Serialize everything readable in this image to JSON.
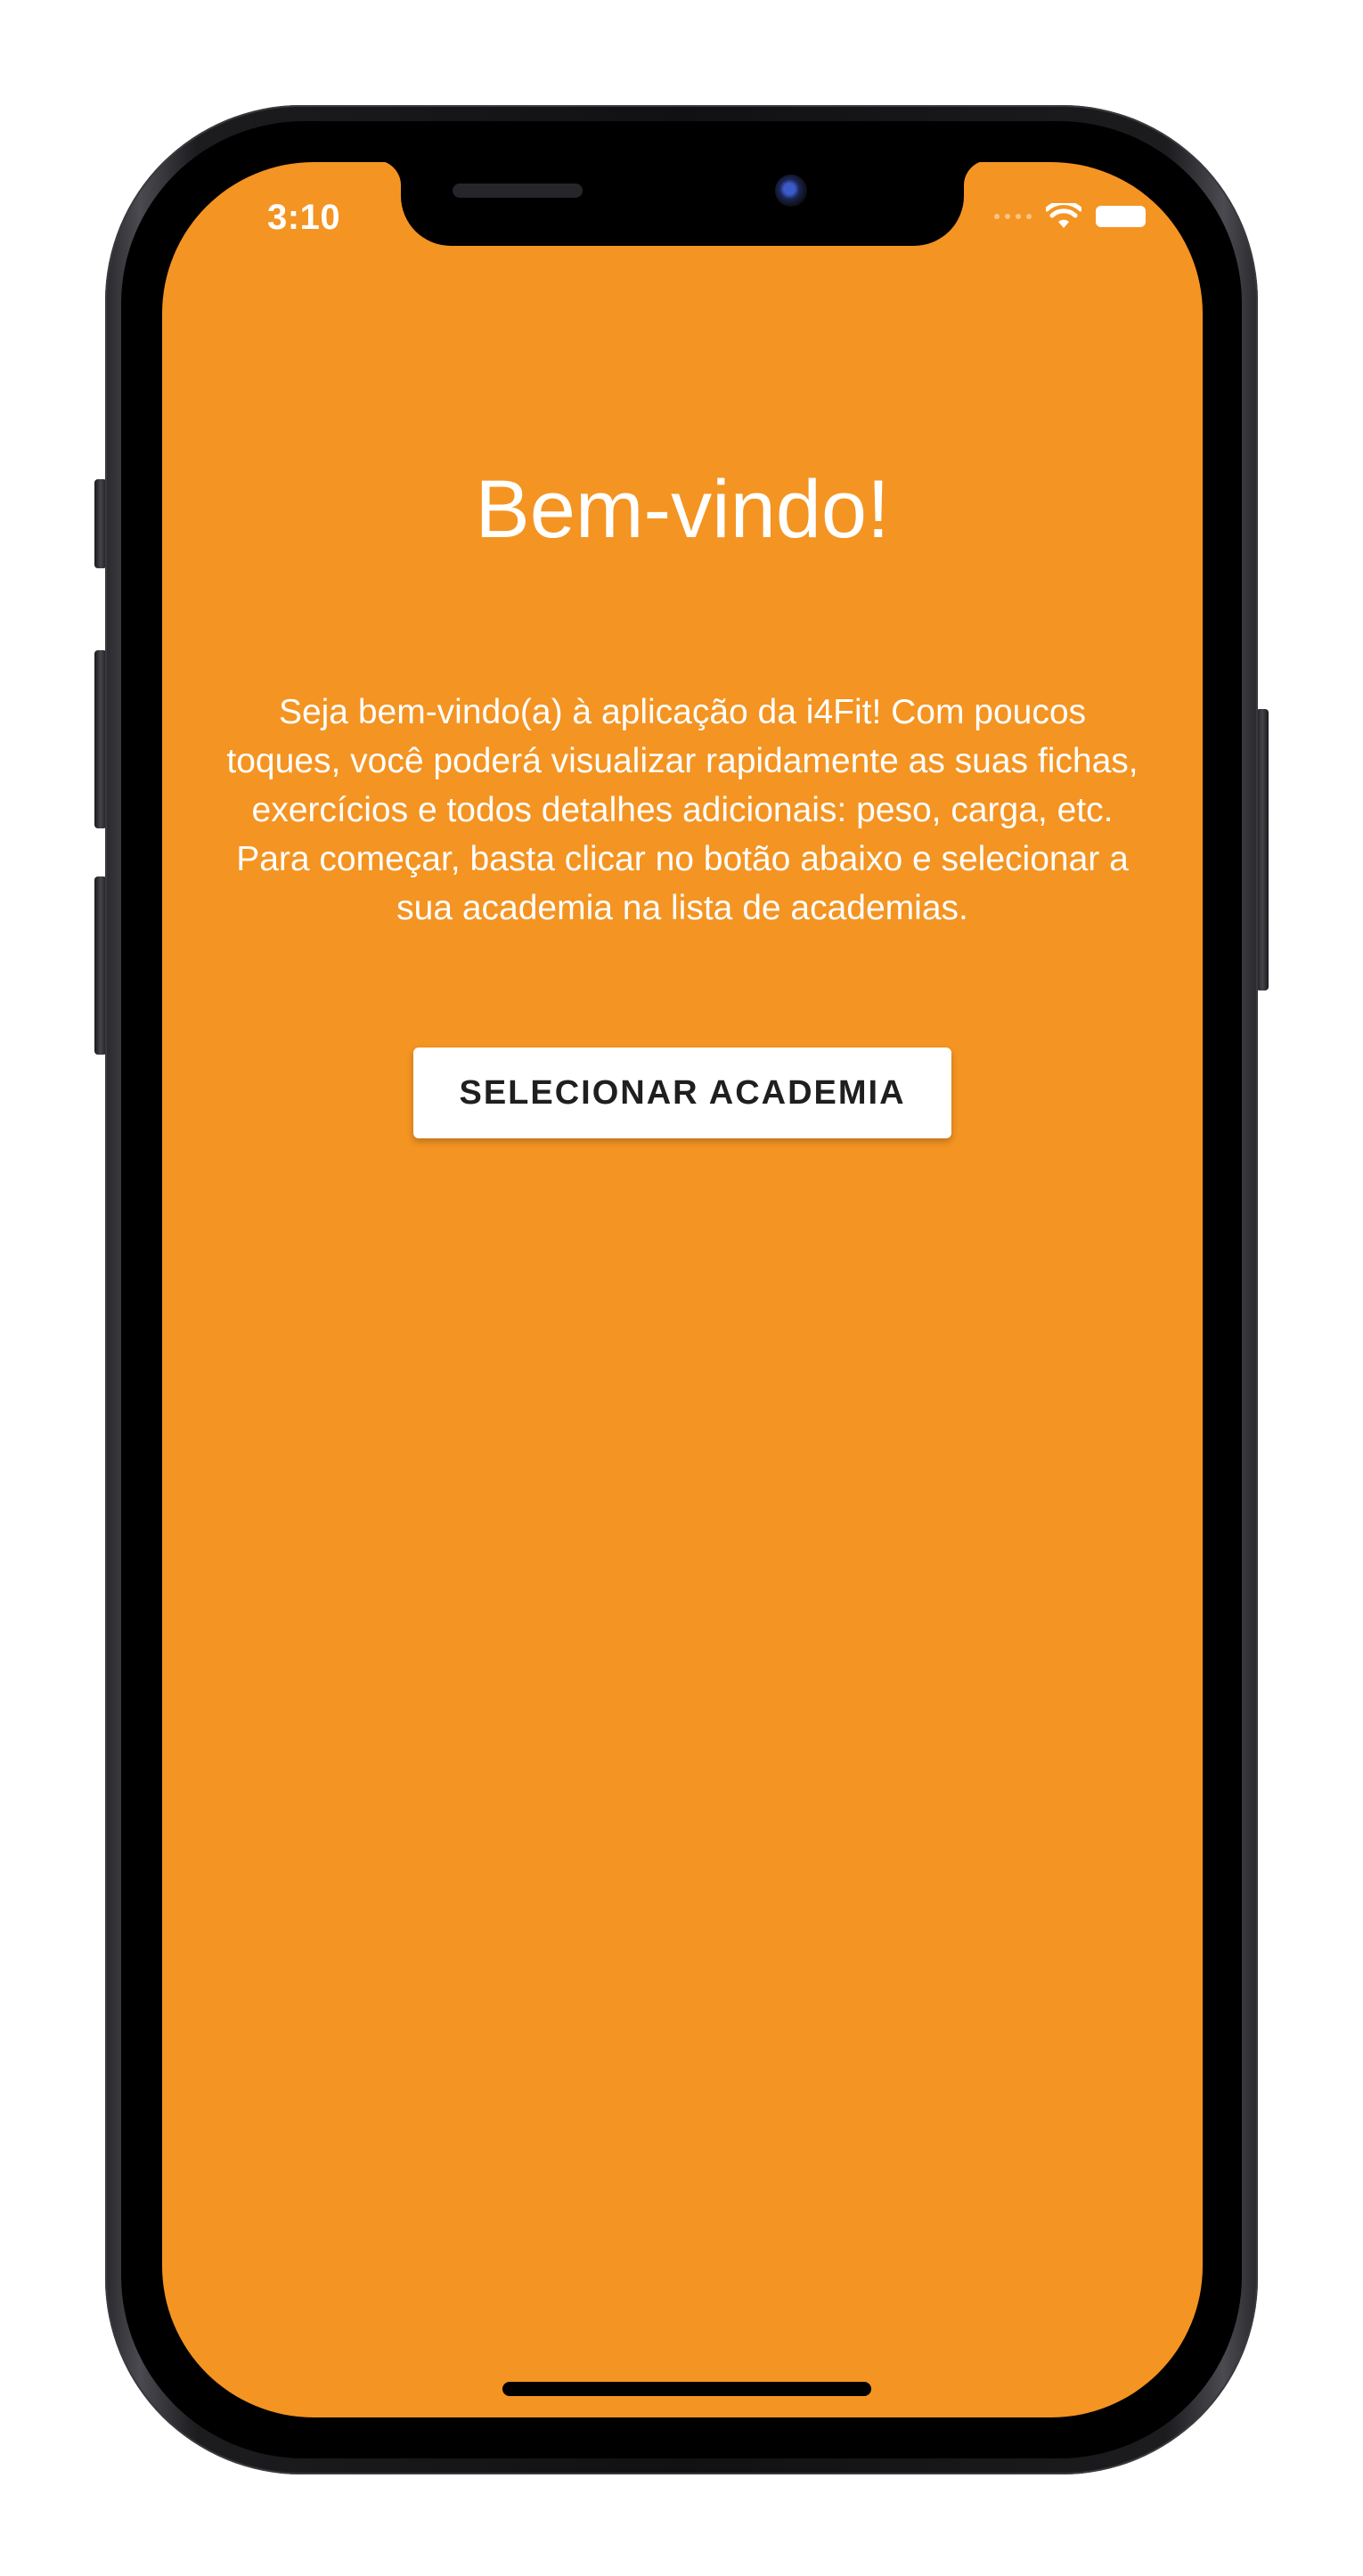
{
  "status_bar": {
    "time": "3:10",
    "icons": [
      "cellular-signal-icon",
      "wifi-icon",
      "battery-icon"
    ]
  },
  "welcome": {
    "title": "Bem-vindo!",
    "description": "Seja bem-vindo(a) à aplicação da i4Fit! Com poucos toques, você poderá visualizar rapidamente as suas fichas, exercícios e todos detalhes adicionais: peso, carga, etc. Para começar, basta clicar no botão abaixo e selecionar a sua academia na lista de academias.",
    "button_label": "SELECIONAR ACADEMIA"
  },
  "colors": {
    "background": "#f49422",
    "text": "#ffffff",
    "button_bg": "#ffffff",
    "button_text": "#1f1f1f"
  }
}
